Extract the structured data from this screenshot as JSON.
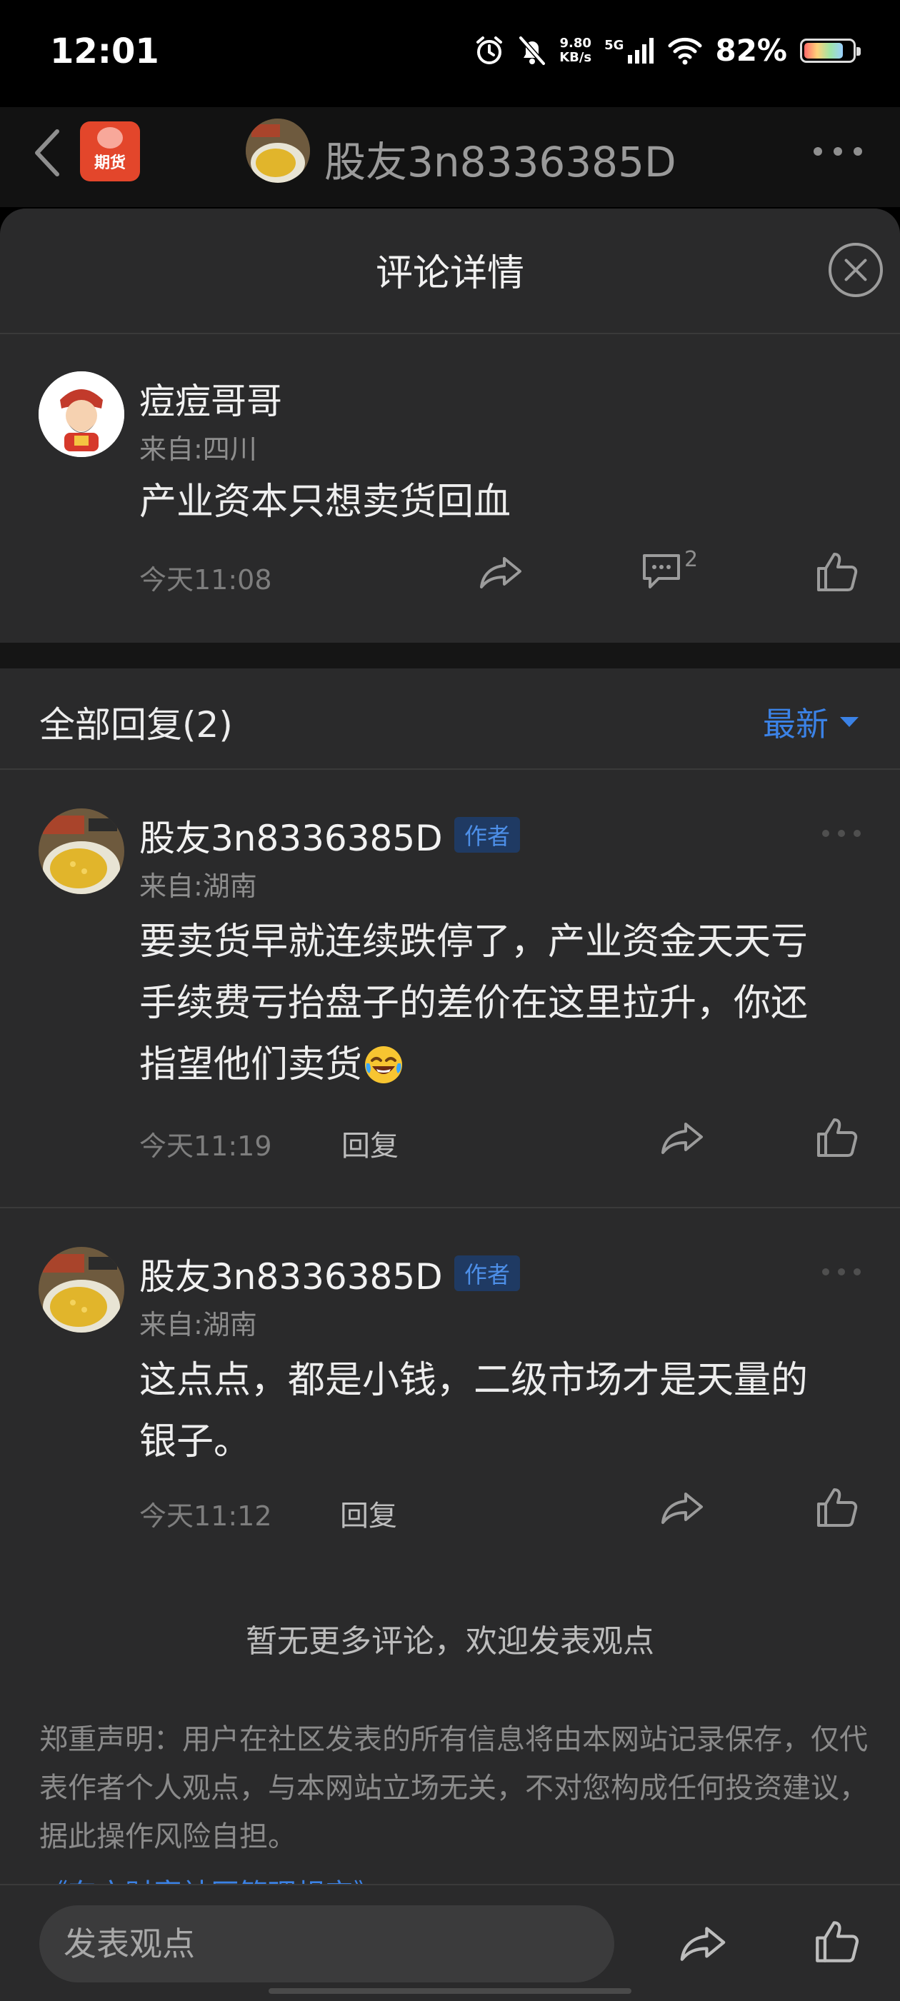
{
  "status_bar": {
    "time": "12:01",
    "net_speed_value": "9.80",
    "net_speed_unit": "KB/s",
    "network_type": "5G",
    "battery_percent": "82%",
    "battery_level": 0.82
  },
  "top_nav": {
    "app_logo_text": "期货",
    "title": "股友3n8336385D"
  },
  "sheet": {
    "title": "评论详情"
  },
  "main_comment": {
    "author": "痘痘哥哥",
    "origin": "来自:四川",
    "content": "产业资本只想卖货回血",
    "time": "今天11:08",
    "reply_count": "2"
  },
  "replies_header": {
    "label": "全部回复(2)",
    "sort_label": "最新"
  },
  "replies": [
    {
      "author": "股友3n8336385D",
      "badge": "作者",
      "origin": "来自:湖南",
      "content_line1": "要卖货早就连续跌停了，产业资金天天亏",
      "content_line2": "手续费亏抬盘子的差价在这里拉升，你还",
      "content_line3": "指望他们卖货",
      "time": "今天11:19",
      "reply_label": "回复"
    },
    {
      "author": "股友3n8336385D",
      "badge": "作者",
      "origin": "来自:湖南",
      "content_line1": "这点点，都是小钱，二级市场才是天量的",
      "content_line2": "银子。",
      "time": "今天11:12",
      "reply_label": "回复"
    }
  ],
  "footer": {
    "no_more": "暂无更多评论，欢迎发表观点",
    "disclaimer": "郑重声明：用户在社区发表的所有信息将由本网站记录保存，仅代表作者个人观点，与本网站立场无关，不对您构成任何投资建议，据此操作风险自担。",
    "rules_link": "《东方财富社区管理规定》"
  },
  "bottom_bar": {
    "input_placeholder": "发表观点"
  },
  "colors": {
    "accent_blue": "#3b82e6",
    "sheet_bg": "#2a2a2b",
    "brand_red": "#e3462b"
  }
}
